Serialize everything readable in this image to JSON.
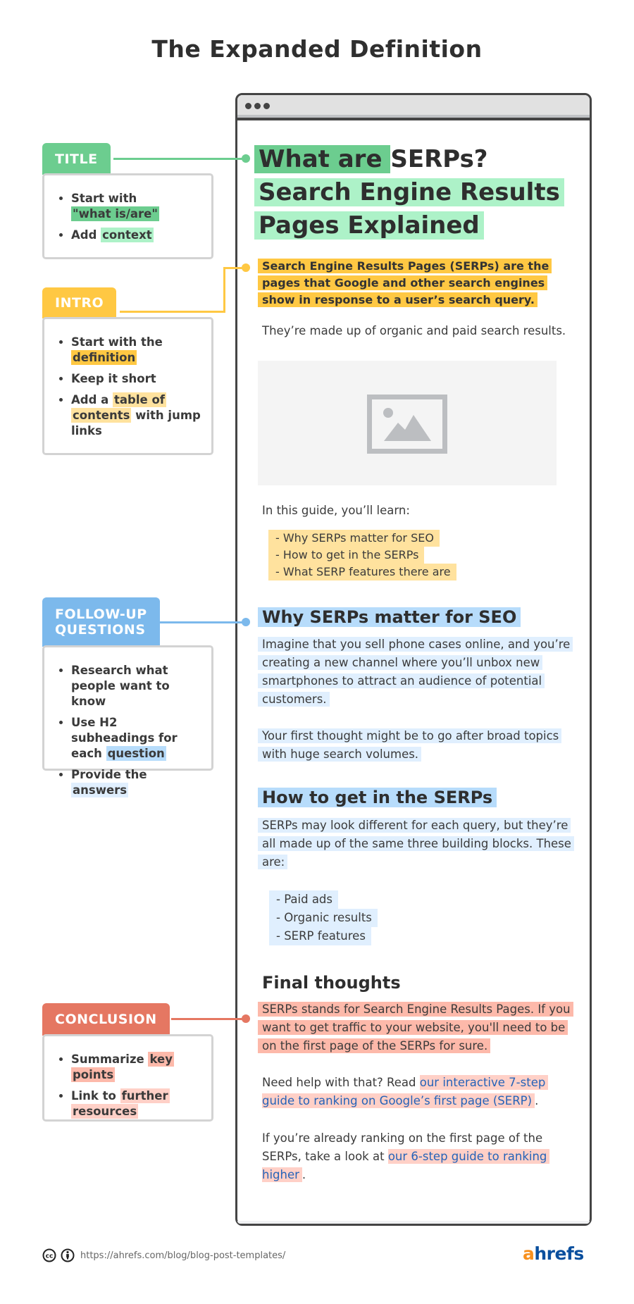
{
  "page_title": "The Expanded Definition",
  "colors": {
    "title": "#6ccd8f",
    "intro": "#ffc843",
    "follow_up": "#7cb9ec",
    "conclusion": "#e57762",
    "window_border": "#444444",
    "link": "#2563b8",
    "ahrefs_orange": "#f7901e",
    "ahrefs_blue": "#0a4f9e"
  },
  "annotations": {
    "title": {
      "label": "TITLE",
      "items": [
        {
          "pre": "Start with ",
          "highlight": "\"what is/are\"",
          "post": ""
        },
        {
          "pre": "Add ",
          "highlight": "context",
          "post": ""
        }
      ]
    },
    "intro": {
      "label": "INTRO",
      "items": [
        {
          "pre": "Start with the ",
          "highlight": "definition",
          "post": ""
        },
        {
          "pre": "Keep it short",
          "highlight": "",
          "post": ""
        },
        {
          "pre": "Add a ",
          "highlight": "table of contents",
          "post": " with jump links"
        }
      ]
    },
    "follow_up": {
      "label_line1": "FOLLOW-UP",
      "label_line2": "QUESTIONS",
      "items": [
        {
          "pre": "Research what people want to know",
          "highlight": "",
          "post": ""
        },
        {
          "pre": "Use H2 subheadings for each ",
          "highlight": "question",
          "post": ""
        },
        {
          "pre": "Provide the ",
          "highlight": "answers",
          "post": ""
        }
      ]
    },
    "conclusion": {
      "label": "CONCLUSION",
      "items": [
        {
          "pre": "Summarize ",
          "highlight": "key points",
          "post": ""
        },
        {
          "pre": "Link to ",
          "highlight": "further resources",
          "post": ""
        }
      ]
    }
  },
  "article": {
    "h1_part1": "What are ",
    "h1_part2": "SERPs?",
    "h1_line2": "Search Engine Results",
    "h1_line3": "Pages Explained",
    "intro_definition": "Search Engine Results Pages (SERPs) are the pages that Google and other search engines show in response to a user’s search query.",
    "intro_secondary": "They’re made up of organic and paid search results.",
    "image_placeholder": "image-icon",
    "toc_intro": "In this guide, you’ll learn:",
    "toc": [
      "- Why SERPs matter for SEO",
      "- How to get in the SERPs",
      "- What SERP features there are"
    ],
    "section1": {
      "heading": "Why SERPs matter for SEO",
      "para1": "Imagine that you sell phone cases online, and you’re creating a new channel where you’ll unbox new smartphones to attract an audience of potential customers.",
      "para2": "Your first thought might be to go after broad topics with huge search volumes."
    },
    "section2": {
      "heading": "How to get in the SERPs",
      "para1": "SERPs may look different for each query, but they’re all made up of the same three building blocks. These are:",
      "list": [
        "- Paid ads",
        "- Organic results",
        "- SERP features"
      ]
    },
    "final": {
      "heading": "Final thoughts",
      "para1": "SERPs stands for Search Engine Results Pages. If you want to get traffic to your website, you'll need to be on the first page of the SERPs for sure.",
      "para2_pre": "Need help with that? Read ",
      "para2_link": "our interactive 7-step guide to ranking on Google’s first page (SERP)",
      "para2_post": ".",
      "para3_pre": "If you’re already ranking on the first page of the SERPs, take a look at ",
      "para3_link": "our 6-step guide to ranking higher",
      "para3_post": "."
    }
  },
  "footer": {
    "url": "https://ahrefs.com/blog/blog-post-templates/",
    "logo_a": "a",
    "logo_rest": "hrefs"
  }
}
